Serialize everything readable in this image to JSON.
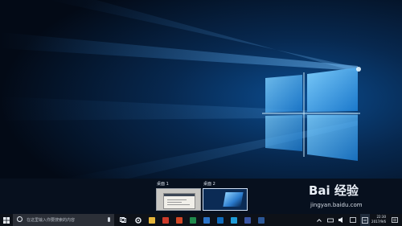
{
  "virtual_desktops": [
    {
      "label": "桌面 1"
    },
    {
      "label": "桌面 2"
    }
  ],
  "taskbar": {
    "search_placeholder": "在这里输入你要搜索的内容",
    "icons": [
      "windows-start-icon",
      "cortana-icon",
      "task-view-icon",
      "settings-icon",
      "file-explorer-icon",
      "word-icon",
      "powerpoint-icon",
      "excel-icon",
      "onenote-icon",
      "outlook-icon",
      "onedrive-icon",
      "visio-icon",
      "word-2-icon"
    ],
    "clock_time": "22:30",
    "clock_date": "2017/9/6",
    "accent": "#0078d7"
  },
  "watermark": {
    "logo": "Bai 经验",
    "url": "jingyan.baidu.com"
  }
}
